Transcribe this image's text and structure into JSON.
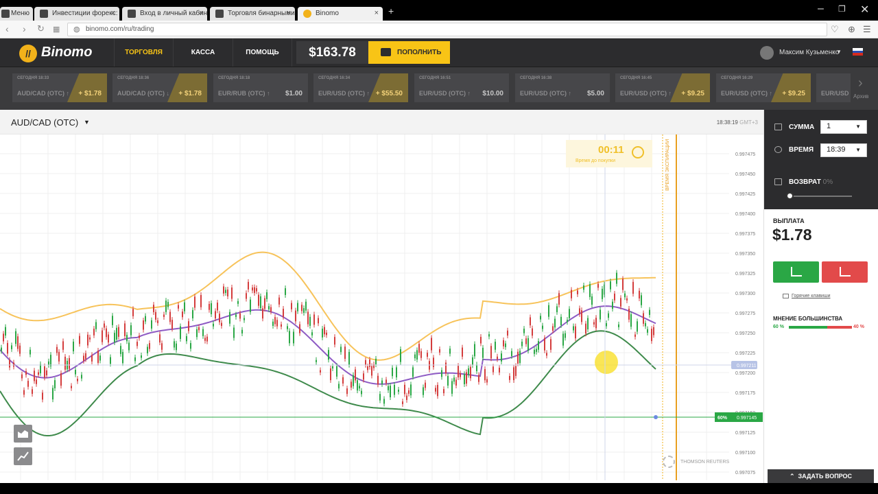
{
  "browser": {
    "tabs": [
      {
        "label": "Меню"
      },
      {
        "label": "Инвестиции форекс: ку..."
      },
      {
        "label": "Вход в личный кабинет..."
      },
      {
        "label": "Торговля бинарными оп..."
      },
      {
        "label": "Binomo"
      }
    ],
    "url": "binomo.com/ru/trading"
  },
  "header": {
    "logo_text": "Binomo",
    "nav": [
      {
        "label": "ТОРГОВЛЯ",
        "active": true
      },
      {
        "label": "КАССА",
        "active": false
      },
      {
        "label": "ПОМОЩЬ",
        "active": false
      }
    ],
    "balance": "$163.78",
    "deposit_label": "ПОПОЛНИТЬ",
    "user_name": "Максим Кузьменко"
  },
  "deals": [
    {
      "time": "СЕГОДНЯ 18:33",
      "pair": "AUD/CAD (OTC) ↑",
      "amount": "+ $1.78",
      "win": true
    },
    {
      "time": "СЕГОДНЯ 18:36",
      "pair": "AUD/CAD (OTC) ↓",
      "amount": "+ $1.78",
      "win": true
    },
    {
      "time": "СЕГОДНЯ 18:18",
      "pair": "EUR/RUB (OTC) ↑",
      "amount": "$1.00",
      "win": false
    },
    {
      "time": "СЕГОДНЯ 16:34",
      "pair": "EUR/USD (OTC) ↑",
      "amount": "+ $55.50",
      "win": true
    },
    {
      "time": "СЕГОДНЯ 16:51",
      "pair": "EUR/USD (OTC) ↑",
      "amount": "$10.00",
      "win": false
    },
    {
      "time": "СЕГОДНЯ 16:38",
      "pair": "EUR/USD (OTC) ↑",
      "amount": "$5.00",
      "win": false
    },
    {
      "time": "СЕГОДНЯ 16:45",
      "pair": "EUR/USD (OTC) ↑",
      "amount": "+ $9.25",
      "win": true
    },
    {
      "time": "СЕГОДНЯ 16:29",
      "pair": "EUR/USD (OTC) ↑",
      "amount": "+ $9.25",
      "win": true
    },
    {
      "time": "",
      "pair": "EUR/USD",
      "amount": "",
      "win": false
    }
  ],
  "archive_label": "Архив",
  "chart": {
    "pair": "AUD/CAD (OTC)",
    "clock": "18:38:19",
    "timezone": "GMT+3",
    "timer_value": "00:11",
    "timer_label": "Время до покупки",
    "expiry_label": "ВРЕМЯ ЭКСПИРАЦИИ",
    "current_price": "0.997211",
    "strike_price": "0.997145",
    "strike_pct": "60%",
    "watermark": "THOMSON REUTERS",
    "price_ticks": [
      "0.997475",
      "0.997450",
      "0.997425",
      "0.997400",
      "0.997375",
      "0.997350",
      "0.997325",
      "0.997300",
      "0.997275",
      "0.997250",
      "0.997225",
      "0.997200",
      "0.997175",
      "0.997150",
      "0.997125",
      "0.997100",
      "0.997075"
    ]
  },
  "panel": {
    "amount_label": "СУММА",
    "amount_value": "1",
    "time_label": "ВРЕМЯ",
    "time_value": "18:39",
    "refund_label": "ВОЗВРАТ",
    "refund_value": "0%",
    "refund_level": 0,
    "payout_label": "ВЫПЛАТА",
    "payout_value": "$1.78",
    "hotkeys_label": "Горячие клавиши",
    "majority_label": "МНЕНИЕ БОЛЬШИНСТВА",
    "majority_up": "60 %",
    "majority_down": "40 %",
    "ask_label": "ЗАДАТЬ ВОПРОС"
  },
  "colors": {
    "accent": "#f8c416",
    "up": "#2aa745",
    "down": "#e24a4a",
    "header_bg": "#2c2c2e"
  }
}
